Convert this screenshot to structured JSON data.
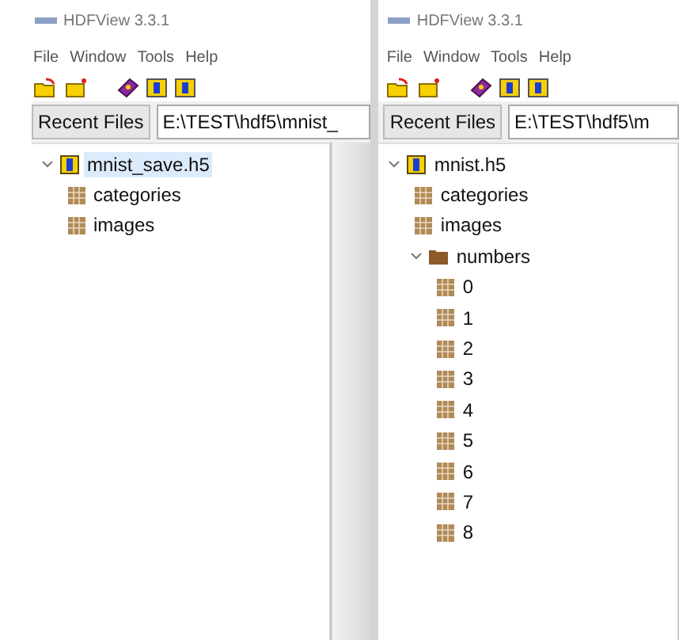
{
  "windows": [
    {
      "title": "HDFView 3.3.1",
      "menu": [
        "File",
        "Window",
        "Tools",
        "Help"
      ],
      "recent_files_button": "Recent Files",
      "path": "E:\\TEST\\hdf5\\mnist_",
      "tree": [
        {
          "label": "mnist_save.h5",
          "kind": "file",
          "expanded": true,
          "selected": true,
          "children": [
            {
              "label": "categories",
              "kind": "dataset",
              "selected": false
            },
            {
              "label": "images",
              "kind": "dataset",
              "selected": false
            }
          ]
        }
      ]
    },
    {
      "title": "HDFView 3.3.1",
      "menu": [
        "File",
        "Window",
        "Tools",
        "Help"
      ],
      "recent_files_button": "Recent Files",
      "path": "E:\\TEST\\hdf5\\m",
      "tree": [
        {
          "label": "mnist.h5",
          "kind": "file",
          "expanded": true,
          "selected": false,
          "children": [
            {
              "label": "categories",
              "kind": "dataset",
              "selected": false
            },
            {
              "label": "images",
              "kind": "dataset",
              "selected": false
            },
            {
              "label": "numbers",
              "kind": "group",
              "expanded": true,
              "selected": false,
              "children": [
                {
                  "label": "0",
                  "kind": "dataset",
                  "selected": false
                },
                {
                  "label": "1",
                  "kind": "dataset",
                  "selected": false
                },
                {
                  "label": "2",
                  "kind": "dataset",
                  "selected": false
                },
                {
                  "label": "3",
                  "kind": "dataset",
                  "selected": false
                },
                {
                  "label": "4",
                  "kind": "dataset",
                  "selected": false
                },
                {
                  "label": "5",
                  "kind": "dataset",
                  "selected": false
                },
                {
                  "label": "6",
                  "kind": "dataset",
                  "selected": false
                },
                {
                  "label": "7",
                  "kind": "dataset",
                  "selected": false
                },
                {
                  "label": "8",
                  "kind": "dataset",
                  "selected": false
                }
              ]
            }
          ]
        }
      ]
    }
  ]
}
